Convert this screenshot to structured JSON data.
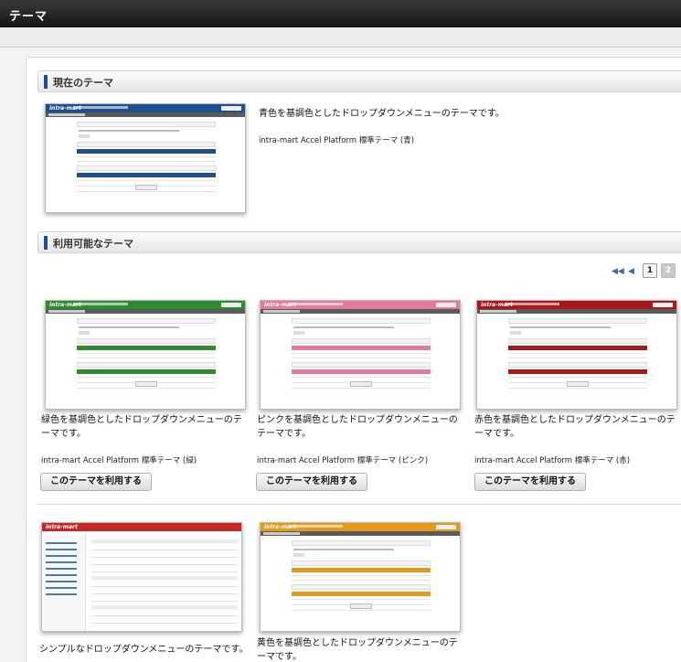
{
  "window": {
    "title": "テーマ"
  },
  "current": {
    "heading": "現在のテーマ",
    "description": "青色を基調色としたドロップダウンメニューのテーマです。",
    "name": "intra-mart Accel Platform 標準テーマ (青)",
    "color": "#1f4f8e"
  },
  "available": {
    "heading": "利用可能なテーマ",
    "pager": {
      "first_icon": "double-left-arrow-icon",
      "prev_icon": "left-arrow-icon",
      "page1": "1",
      "page2": "2"
    },
    "themes": [
      {
        "description": "緑色を基調色としたドロップダウンメニューのテーマです。",
        "name": "intra-mart Accel Platform 標準テーマ (緑)",
        "button": "このテーマを利用する",
        "color": "#2e8b2e"
      },
      {
        "description": "ピンクを基調色としたドロップダウンメニューのテーマです。",
        "name": "intra-mart Accel Platform 標準テーマ (ピンク)",
        "button": "このテーマを利用する",
        "color": "#e6799a"
      },
      {
        "description": "赤色を基調色としたドロップダウンメニューのテーマです。",
        "name": "intra-mart Accel Platform 標準テーマ (赤)",
        "button": "このテーマを利用する",
        "color": "#a81818"
      },
      {
        "description": "シンプルなドロップダウンメニューのテーマです。",
        "color": "#c62828"
      },
      {
        "description": "黄色を基調色としたドロップダウンメニューのテーマです。",
        "color": "#e39a1a"
      }
    ]
  },
  "thumb_logo": "intra-mart"
}
